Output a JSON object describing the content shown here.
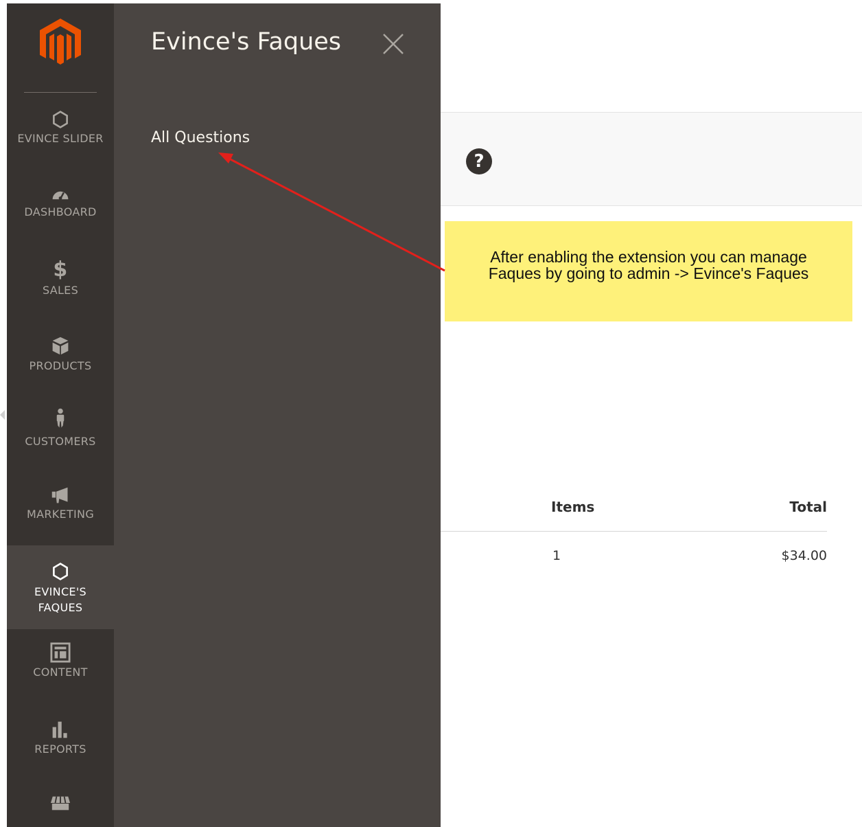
{
  "sidebar": {
    "items": [
      {
        "label": "EVINCE SLIDER",
        "icon": "hexagon-icon"
      },
      {
        "label": "DASHBOARD",
        "icon": "speedometer-icon"
      },
      {
        "label": "SALES",
        "icon": "dollar-icon",
        "glyph": "$"
      },
      {
        "label": "PRODUCTS",
        "icon": "box-icon"
      },
      {
        "label": "CUSTOMERS",
        "icon": "person-icon"
      },
      {
        "label": "MARKETING",
        "icon": "megaphone-icon"
      },
      {
        "label": "EVINCE'S\nFAQUES",
        "icon": "hexagon-icon",
        "active": true
      },
      {
        "label": "CONTENT",
        "icon": "layout-icon"
      },
      {
        "label": "REPORTS",
        "icon": "bar-chart-icon"
      },
      {
        "label": "",
        "icon": "store-icon"
      }
    ]
  },
  "flyout": {
    "title": "Evince's Faques",
    "links": [
      "All Questions"
    ]
  },
  "annotation": {
    "line1": "After enabling the extension you can manage",
    "line2": "Faques by going to admin -> Evince's Faques"
  },
  "help_glyph": "?",
  "table": {
    "headers": {
      "items": "Items",
      "total": "Total"
    },
    "rows": [
      {
        "items": "1",
        "total": "$34.00"
      }
    ]
  },
  "colors": {
    "sidebar_bg": "#373330",
    "flyout_bg": "#4a4542",
    "brand_orange": "#eb5202",
    "note_bg": "#fef17a",
    "arrow": "#e3201b"
  }
}
